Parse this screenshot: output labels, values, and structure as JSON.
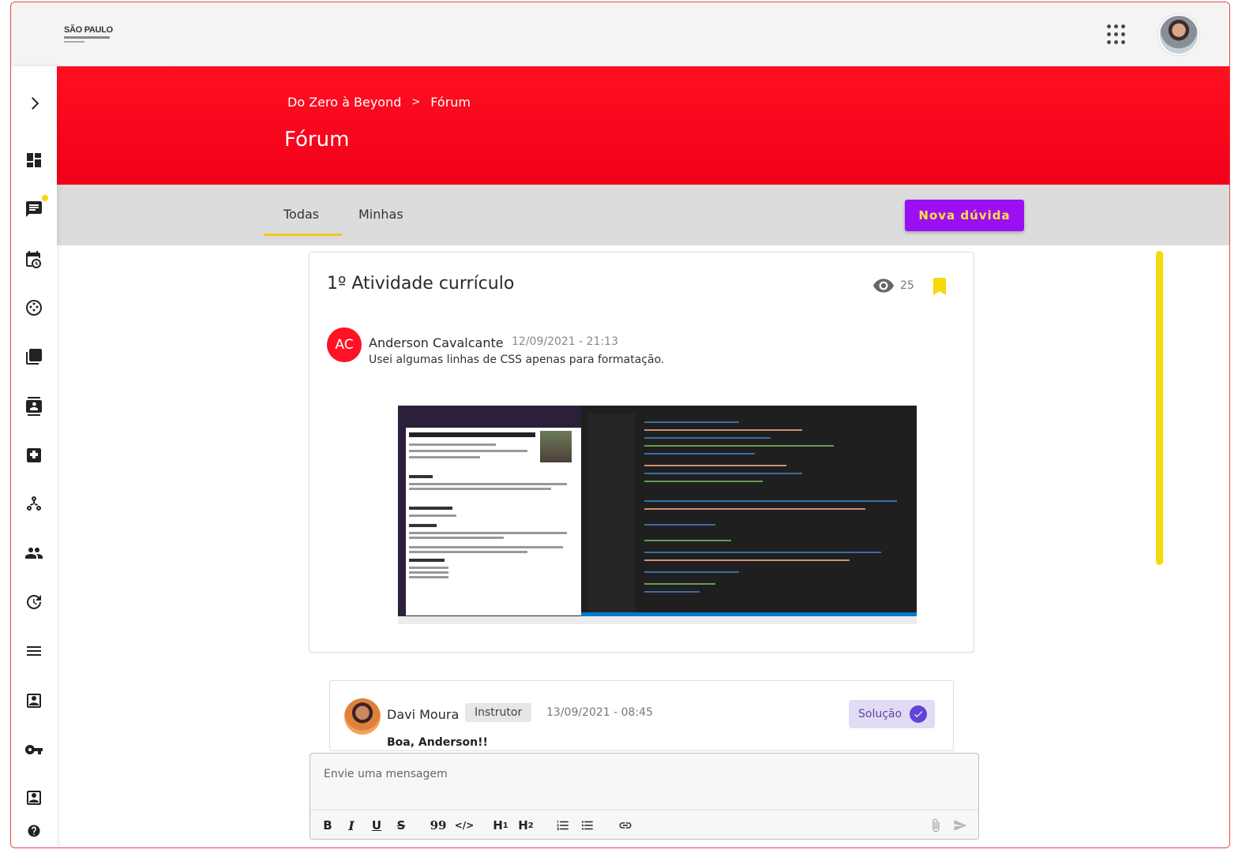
{
  "header": {
    "logo_text": "SÃO PAULO"
  },
  "breadcrumb": {
    "items": [
      "Do Zero à Beyond",
      "Fórum"
    ],
    "separator": ">"
  },
  "page": {
    "title": "Fórum"
  },
  "tabs": [
    {
      "label": "Todas",
      "active": true
    },
    {
      "label": "Minhas",
      "active": false
    }
  ],
  "actions": {
    "new_question": "Nova dúvida"
  },
  "post": {
    "title": "1º Atividade currículo",
    "views": "25",
    "author_initials": "AC",
    "author": "Anderson Cavalcante",
    "date": "12/09/2021 - 21:13",
    "body": "Usei algumas linhas de CSS apenas para formatação."
  },
  "reply": {
    "author": "Davi Moura",
    "role_badge": "Instrutor",
    "date": "13/09/2021 - 08:45",
    "solution_label": "Solução",
    "text": "Boa, Anderson!!"
  },
  "composer": {
    "placeholder": "Envie uma mensagem",
    "toolbar": {
      "bold": "B",
      "italic": "I",
      "underline": "U",
      "strike": "S",
      "quote": "99",
      "code": "</>",
      "h1": "H",
      "h1_sub": "1",
      "h2": "H",
      "h2_sub": "2"
    }
  },
  "colors": {
    "brand_red": "#ff0a1a",
    "accent_purple": "#9b10f2",
    "accent_yellow": "#f5d90a",
    "solution_bg": "#e2dbf4"
  },
  "sidebar_icons": [
    "chevron-right-icon",
    "dashboard-icon",
    "chat-icon",
    "calendar-clock-icon",
    "palette-icon",
    "library-icon",
    "contacts-book-icon",
    "extension-icon",
    "network-icon",
    "people-icon",
    "history-icon",
    "menu-icon",
    "account-box-icon",
    "key-icon",
    "account-box-icon",
    "help-icon"
  ]
}
